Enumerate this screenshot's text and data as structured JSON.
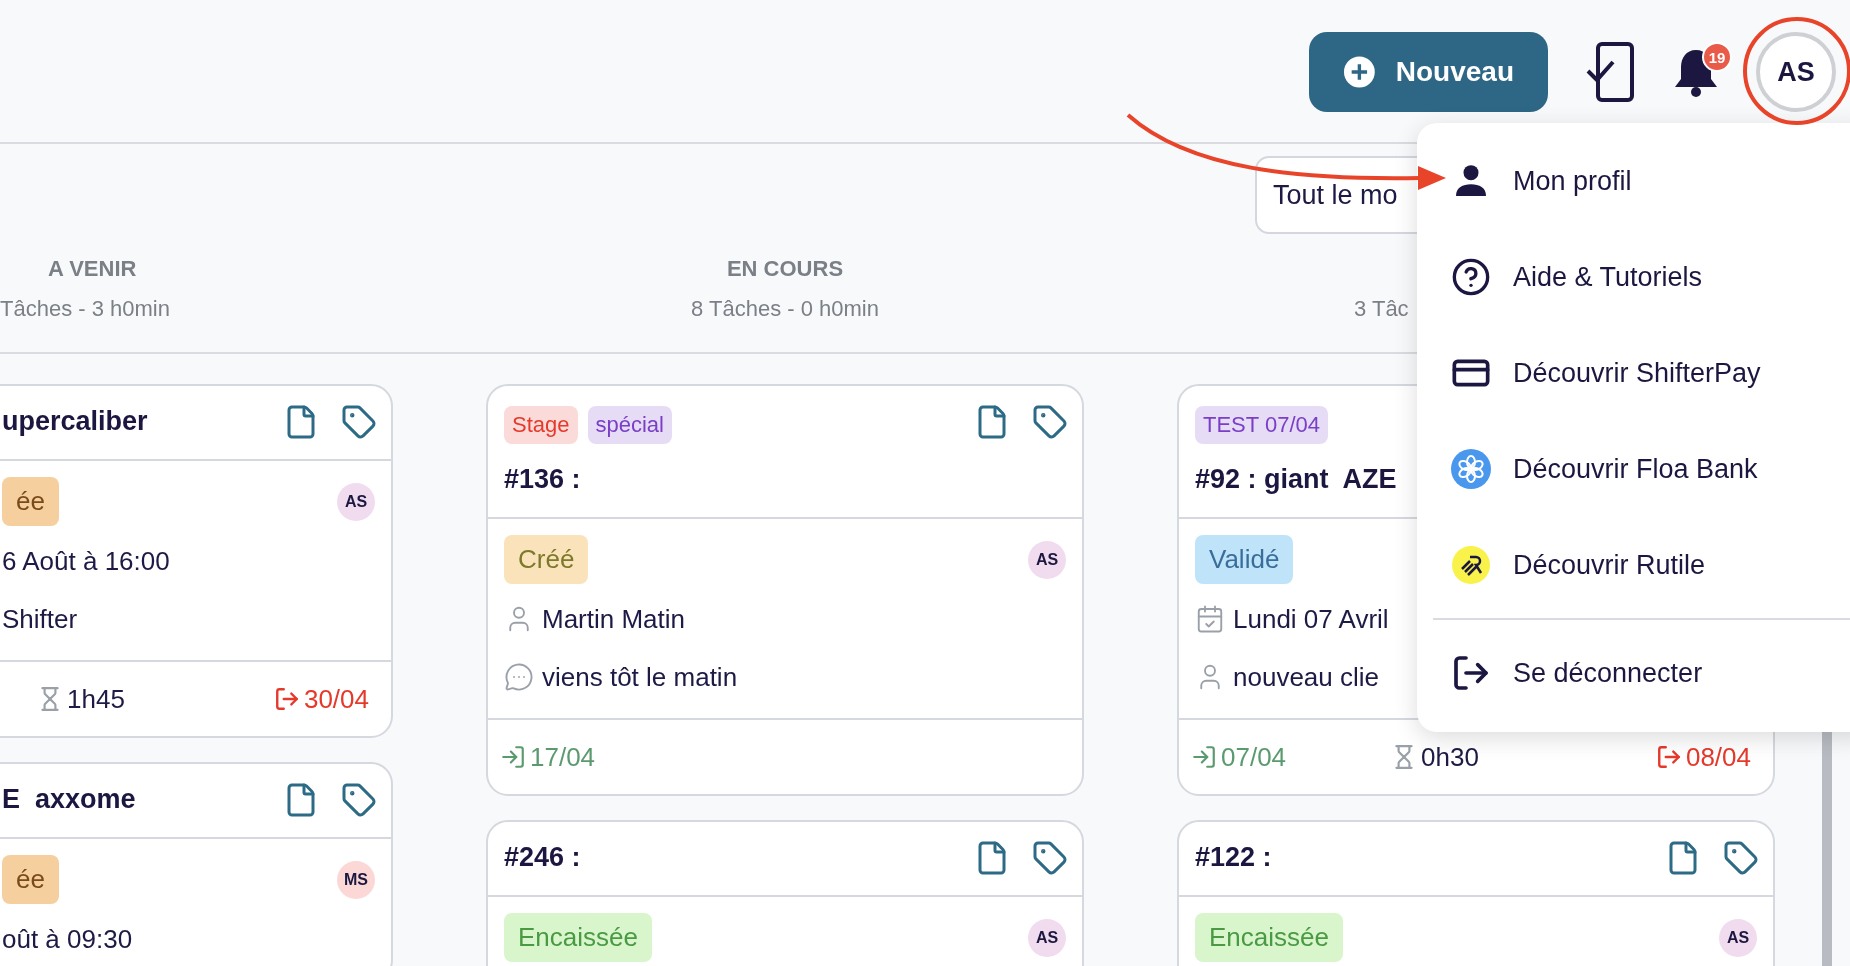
{
  "topbar": {
    "new_button": "Nouveau",
    "notifications": "19",
    "user_initials": "AS"
  },
  "filter": {
    "value": "Tout le mo"
  },
  "columns": [
    {
      "title": "A VENIR",
      "summary": "Tâches - 3 h0min",
      "cards": [
        {
          "title": "upercaliber",
          "status": {
            "label": "ée",
            "kind": "pending"
          },
          "assignee": {
            "initials": "AS",
            "color": "#f1dcef"
          },
          "lines": [
            {
              "kind": "plain",
              "text": "6 Août à 16:00"
            },
            {
              "kind": "plain",
              "text": "Shifter"
            }
          ],
          "footer": {
            "duration": "1h45",
            "end": "30/04"
          }
        },
        {
          "title": "E  axxome",
          "status": {
            "label": "ée",
            "kind": "pending"
          },
          "assignee": {
            "initials": "MS",
            "color": "#fbd8d5"
          },
          "lines": [
            {
              "kind": "plain",
              "text": "oût à 09:30"
            }
          ]
        }
      ]
    },
    {
      "title": "EN COURS",
      "summary": "8 Tâches - 0 h0min",
      "cards": [
        {
          "tags": [
            {
              "label": "Stage",
              "color": "#e5392b"
            },
            {
              "label": "spécial",
              "color": "#7a3fc7"
            }
          ],
          "title": "#136 :",
          "status": {
            "label": "Créé",
            "kind": "created"
          },
          "assignee": {
            "initials": "AS",
            "color": "#f1dcef"
          },
          "lines": [
            {
              "kind": "client",
              "text": "Martin Matin"
            },
            {
              "kind": "comment",
              "text": "viens tôt le matin"
            }
          ],
          "footer": {
            "start": "17/04"
          }
        },
        {
          "title": "#246 :",
          "status": {
            "label": "Encaissée",
            "kind": "cashed"
          },
          "assignee": {
            "initials": "AS",
            "color": "#f1dcef"
          }
        }
      ]
    },
    {
      "summary": "3 Tâc",
      "cards": [
        {
          "tags": [
            {
              "label": "TEST 07/04",
              "color": "#7a3fc7"
            }
          ],
          "title": "#92 : giant  AZE",
          "actions": false,
          "status": {
            "label": "Validé",
            "kind": "validated"
          },
          "lines": [
            {
              "kind": "date",
              "text": "Lundi 07 Avril"
            },
            {
              "kind": "client",
              "text": "nouveau clie"
            }
          ],
          "footer": {
            "start": "07/04",
            "duration": "0h30",
            "end": "08/04"
          }
        },
        {
          "title": "#122 :",
          "status": {
            "label": "Encaissée",
            "kind": "cashed"
          },
          "assignee": {
            "initials": "AS",
            "color": "#f1dcef"
          }
        }
      ]
    }
  ],
  "menu": {
    "items": [
      {
        "kind": "profile",
        "label": "Mon profil"
      },
      {
        "kind": "help",
        "label": "Aide & Tutoriels"
      },
      {
        "kind": "card",
        "label": "Découvrir ShifterPay"
      },
      {
        "kind": "floa",
        "label": "Découvrir Floa Bank"
      },
      {
        "kind": "rutile",
        "label": "Découvrir Rutile"
      }
    ],
    "footer_items": [
      {
        "kind": "logout",
        "label": "Se déconnecter"
      }
    ]
  }
}
